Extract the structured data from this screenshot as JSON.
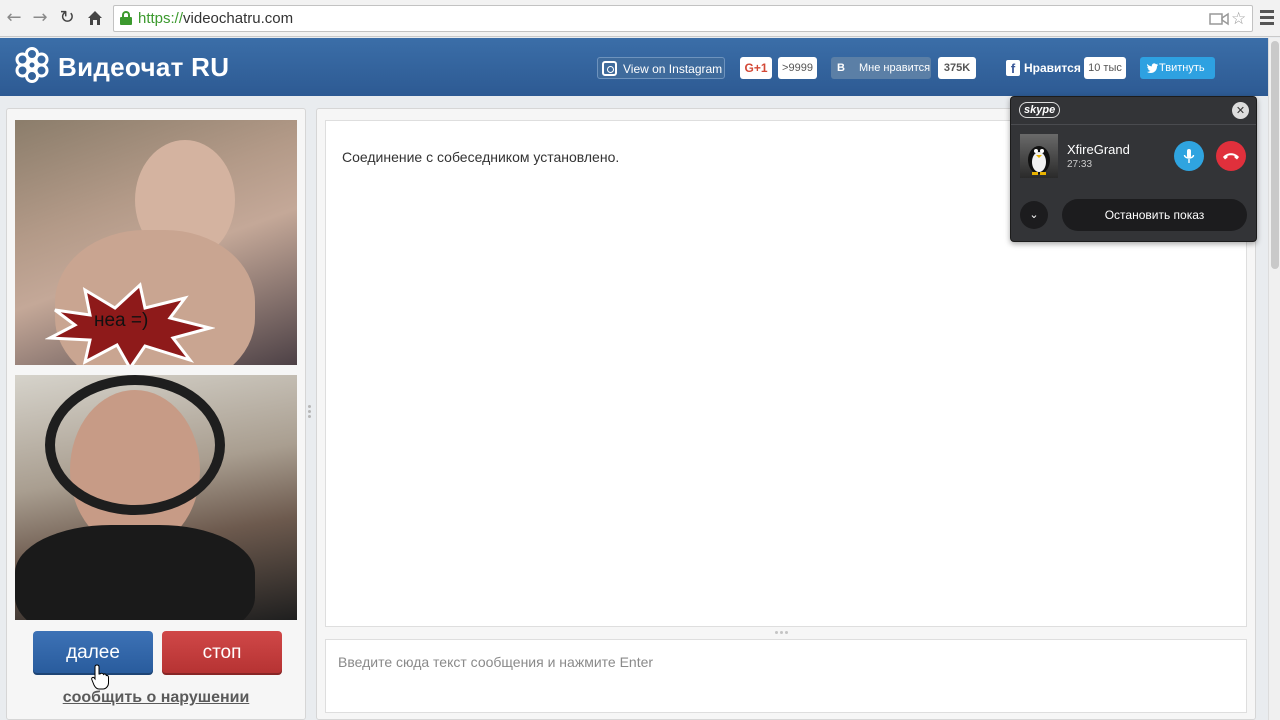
{
  "browser": {
    "back_icon": "back-arrow-icon",
    "forward_icon": "forward-arrow-icon",
    "reload_icon": "reload-icon",
    "home_icon": "home-icon",
    "url_scheme": "https://",
    "url_host": "videochatru.com",
    "star_icon": "star-icon",
    "menu_icon": "hamburger-menu-icon"
  },
  "header": {
    "logo_text": "Видеочат RU",
    "instagram_label": "View on Instagram",
    "gplus_label": "G+1",
    "gplus_count": ">9999",
    "vk_letter": "В",
    "vk_label": "Мне нравится",
    "vk_count": "375K",
    "fb_label": "Нравится",
    "fb_count": "10 тыс",
    "twitter_label": "Твитнуть",
    "colors": {
      "header": "#2d5a93",
      "vk": "#5b7fa6",
      "twitter": "#2ea1e1"
    }
  },
  "videos": {
    "remote_caption": "неа =)"
  },
  "controls": {
    "next_label": "далее",
    "stop_label": "стоп",
    "report_label": "сообщить о нарушении",
    "colors": {
      "next": "#2d64a8",
      "stop": "#c43c3c"
    }
  },
  "chat": {
    "message": "Соединение с собеседником установлено.",
    "input_placeholder": "Введите сюда текст сообщения и нажмите Enter"
  },
  "skype": {
    "logo": "skype",
    "contact_name": "XfireGrand",
    "call_time": "27:33",
    "stop_share_label": "Остановить показ",
    "colors": {
      "mic": "#2fa4e0",
      "hangup": "#e0303c"
    }
  }
}
